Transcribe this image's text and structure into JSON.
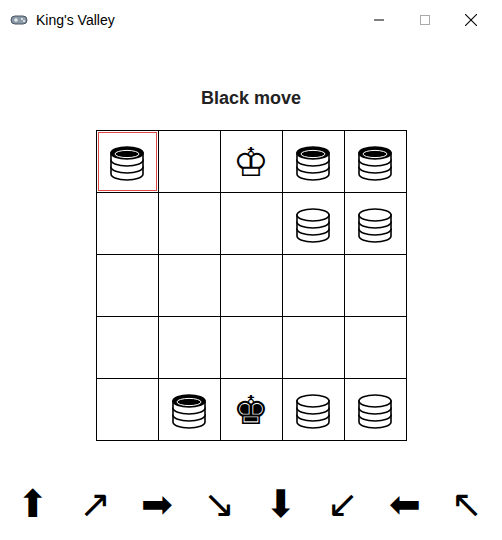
{
  "window": {
    "title": "King's Valley"
  },
  "status": "Black move",
  "board": [
    [
      {
        "kind": "stack",
        "side": "black",
        "symbol": "",
        "selected": true
      },
      {
        "kind": "empty",
        "side": "",
        "symbol": "",
        "selected": false
      },
      {
        "kind": "king",
        "side": "white",
        "symbol": "♔",
        "selected": false
      },
      {
        "kind": "stack",
        "side": "black",
        "symbol": "",
        "selected": false
      },
      {
        "kind": "stack",
        "side": "black",
        "symbol": "",
        "selected": false
      }
    ],
    [
      {
        "kind": "empty",
        "side": "",
        "symbol": "",
        "selected": false
      },
      {
        "kind": "empty",
        "side": "",
        "symbol": "",
        "selected": false
      },
      {
        "kind": "empty",
        "side": "",
        "symbol": "",
        "selected": false
      },
      {
        "kind": "stack",
        "side": "white",
        "symbol": "",
        "selected": false
      },
      {
        "kind": "stack",
        "side": "white",
        "symbol": "",
        "selected": false
      }
    ],
    [
      {
        "kind": "empty",
        "side": "",
        "symbol": "",
        "selected": false
      },
      {
        "kind": "empty",
        "side": "",
        "symbol": "",
        "selected": false
      },
      {
        "kind": "empty",
        "side": "",
        "symbol": "",
        "selected": false
      },
      {
        "kind": "empty",
        "side": "",
        "symbol": "",
        "selected": false
      },
      {
        "kind": "empty",
        "side": "",
        "symbol": "",
        "selected": false
      }
    ],
    [
      {
        "kind": "empty",
        "side": "",
        "symbol": "",
        "selected": false
      },
      {
        "kind": "empty",
        "side": "",
        "symbol": "",
        "selected": false
      },
      {
        "kind": "empty",
        "side": "",
        "symbol": "",
        "selected": false
      },
      {
        "kind": "empty",
        "side": "",
        "symbol": "",
        "selected": false
      },
      {
        "kind": "empty",
        "side": "",
        "symbol": "",
        "selected": false
      }
    ],
    [
      {
        "kind": "empty",
        "side": "",
        "symbol": "",
        "selected": false
      },
      {
        "kind": "stack",
        "side": "black",
        "symbol": "",
        "selected": false
      },
      {
        "kind": "king",
        "side": "black",
        "symbol": "♚",
        "selected": false
      },
      {
        "kind": "stack",
        "side": "white",
        "symbol": "",
        "selected": false
      },
      {
        "kind": "stack",
        "side": "white",
        "symbol": "",
        "selected": false
      }
    ]
  ],
  "directions": [
    "⬆",
    "↗",
    "➡",
    "↘",
    "⬇",
    "↙",
    "⬅",
    "↖"
  ]
}
